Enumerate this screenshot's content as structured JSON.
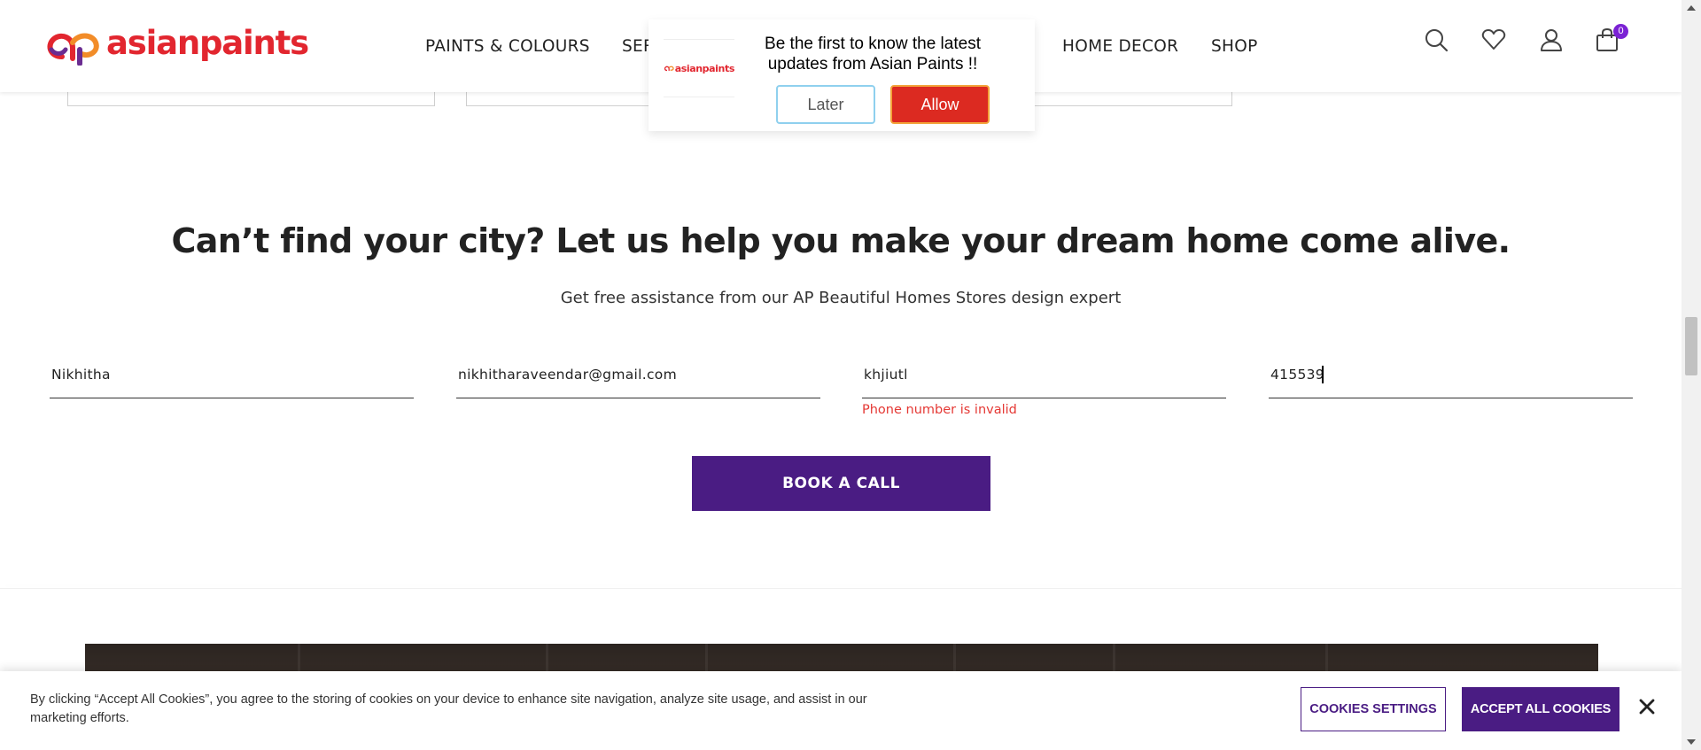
{
  "header": {
    "logo_text": "asianpaints",
    "nav": [
      {
        "label": "PAINTS & COLOURS"
      },
      {
        "label": "SER"
      },
      {
        "label": "HOME DECOR"
      },
      {
        "label": "SHOP"
      }
    ],
    "cart_count": "0",
    "icons": [
      "search-icon",
      "heart-icon",
      "user-icon",
      "cart-icon"
    ]
  },
  "push_prompt": {
    "logo_text": "asianpaints",
    "message": "Be the first to know the latest updates from Asian Paints !!",
    "later_label": "Later",
    "allow_label": "Allow"
  },
  "lead_form": {
    "headline": "Can’t find your city? Let us help you make your dream home come alive.",
    "subheadline": "Get free assistance from our AP Beautiful Homes Stores design expert",
    "fields": {
      "name": "Nikhitha",
      "email": "nikhitharaveendar@gmail.com",
      "phone": "khjiutl",
      "pincode": "415539"
    },
    "phone_error": "Phone number is invalid",
    "submit_label": "BOOK A CALL"
  },
  "cookie_banner": {
    "text": "By clicking “Accept All Cookies”, you agree to the storing of cookies on your device to enhance site navigation, analyze site usage, and assist in our marketing efforts.",
    "settings_label": "COOKIES SETTINGS",
    "accept_label": "ACCEPT ALL COOKIES"
  },
  "colors": {
    "brand_red": "#e2262f",
    "brand_purple": "#4a1c83",
    "allow_red": "#dc2a21",
    "error_red": "#e53935",
    "badge_purple": "#7b22d4"
  }
}
